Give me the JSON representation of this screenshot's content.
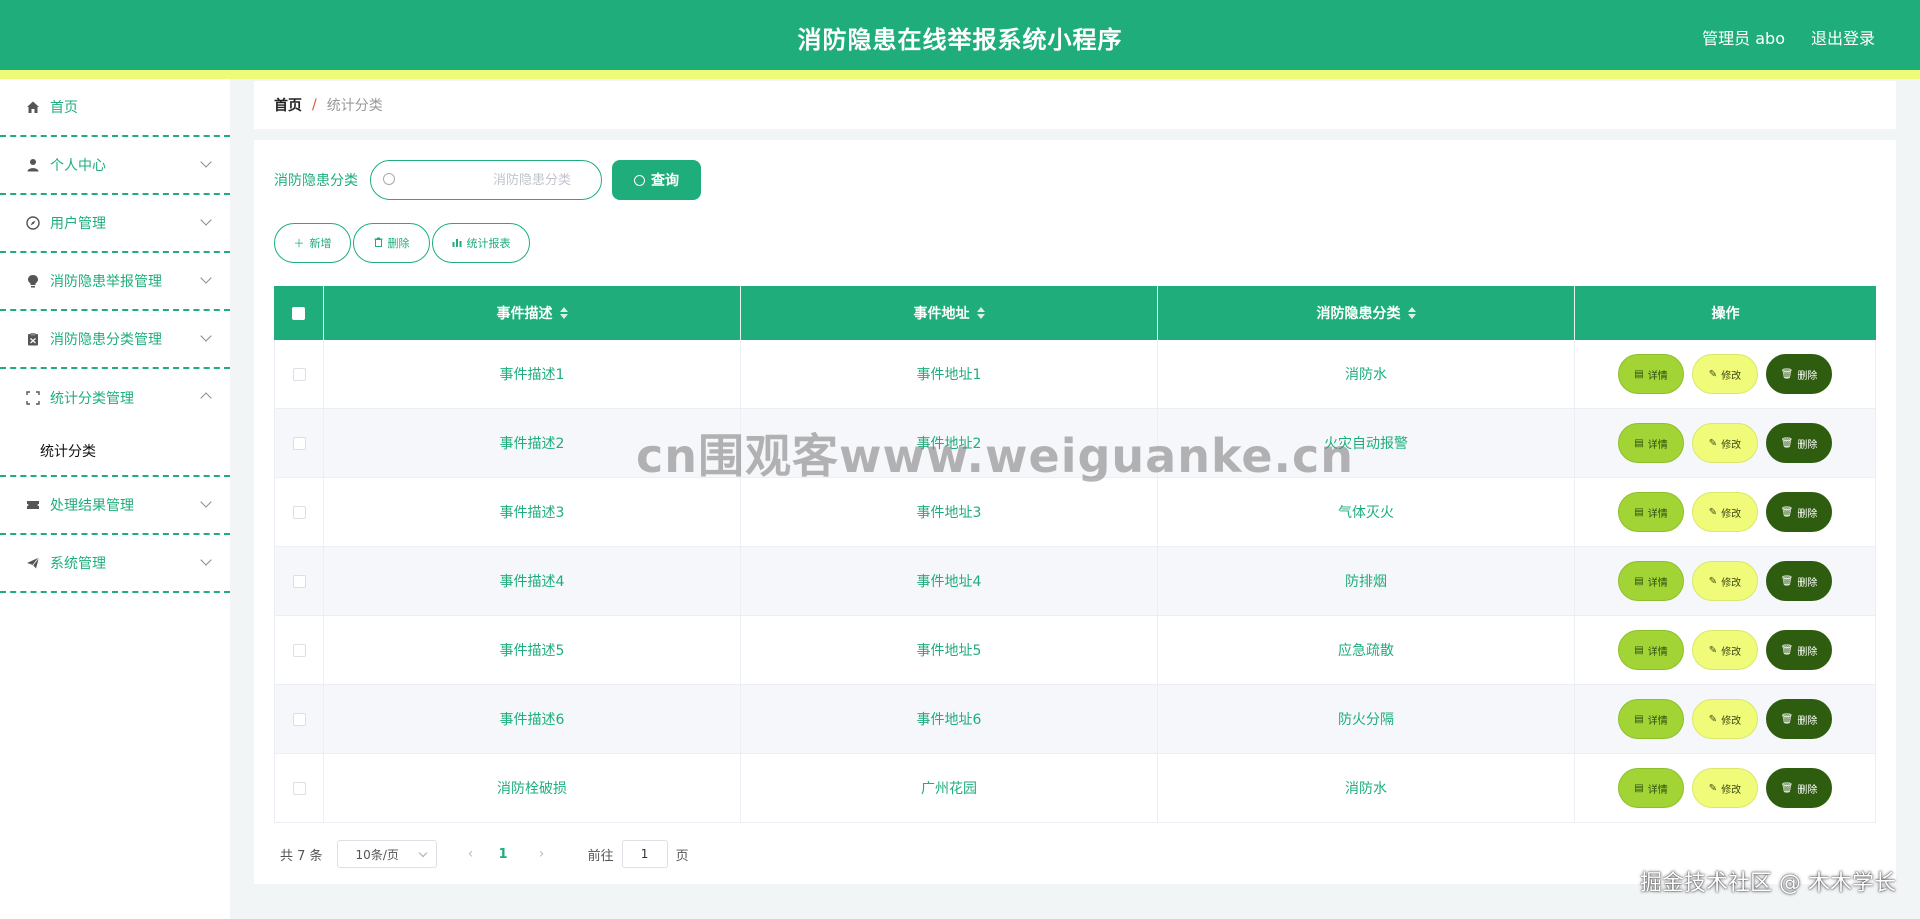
{
  "header": {
    "title": "消防隐患在线举报系统小程序",
    "user": "管理员 abo",
    "logout": "退出登录"
  },
  "sidebar": {
    "items": [
      {
        "label": "首页",
        "icon": "home-icon"
      },
      {
        "label": "个人中心",
        "icon": "user-icon"
      },
      {
        "label": "用户管理",
        "icon": "compass-icon"
      },
      {
        "label": "消防隐患举报管理",
        "icon": "bulb-icon"
      },
      {
        "label": "消防隐患分类管理",
        "icon": "clipboard-icon"
      },
      {
        "label": "统计分类管理",
        "icon": "scan-icon"
      },
      {
        "label": "处理结果管理",
        "icon": "ticket-icon"
      },
      {
        "label": "系统管理",
        "icon": "send-icon"
      }
    ],
    "submenu": {
      "label": "统计分类"
    }
  },
  "breadcrumb": {
    "home": "首页",
    "separator": "/",
    "current": "统计分类"
  },
  "search": {
    "label": "消防隐患分类",
    "placeholder": "消防隐患分类",
    "query_label": "查询"
  },
  "actions": {
    "add": "新增",
    "delete": "删除",
    "report": "统计报表"
  },
  "table": {
    "headers": [
      "事件描述",
      "事件地址",
      "消防隐患分类",
      "操作"
    ],
    "rows": [
      {
        "desc": "事件描述1",
        "addr": "事件地址1",
        "category": "消防水"
      },
      {
        "desc": "事件描述2",
        "addr": "事件地址2",
        "category": "火灾自动报警"
      },
      {
        "desc": "事件描述3",
        "addr": "事件地址3",
        "category": "气体灭火"
      },
      {
        "desc": "事件描述4",
        "addr": "事件地址4",
        "category": "防排烟"
      },
      {
        "desc": "事件描述5",
        "addr": "事件地址5",
        "category": "应急疏散"
      },
      {
        "desc": "事件描述6",
        "addr": "事件地址6",
        "category": "防火分隔"
      },
      {
        "desc": "消防栓破损",
        "addr": "广州花园",
        "category": "消防水"
      }
    ],
    "ops": {
      "detail": "详情",
      "edit": "修改",
      "delete": "删除"
    }
  },
  "pagination": {
    "total": "共 7 条",
    "page_size": "10条/页",
    "current_page": "1",
    "goto_prefix": "前往",
    "goto_value": "1",
    "goto_suffix": "页"
  },
  "watermark": "cn围观客www.weiguanke.cn",
  "corner_mark": "掘金技术社区 @ 木木学长",
  "colors": {
    "primary": "#1fae7b",
    "strip": "#eefb79",
    "detail": "#a3d436",
    "edit": "#f0fb79",
    "danger": "#2f5d0f"
  }
}
